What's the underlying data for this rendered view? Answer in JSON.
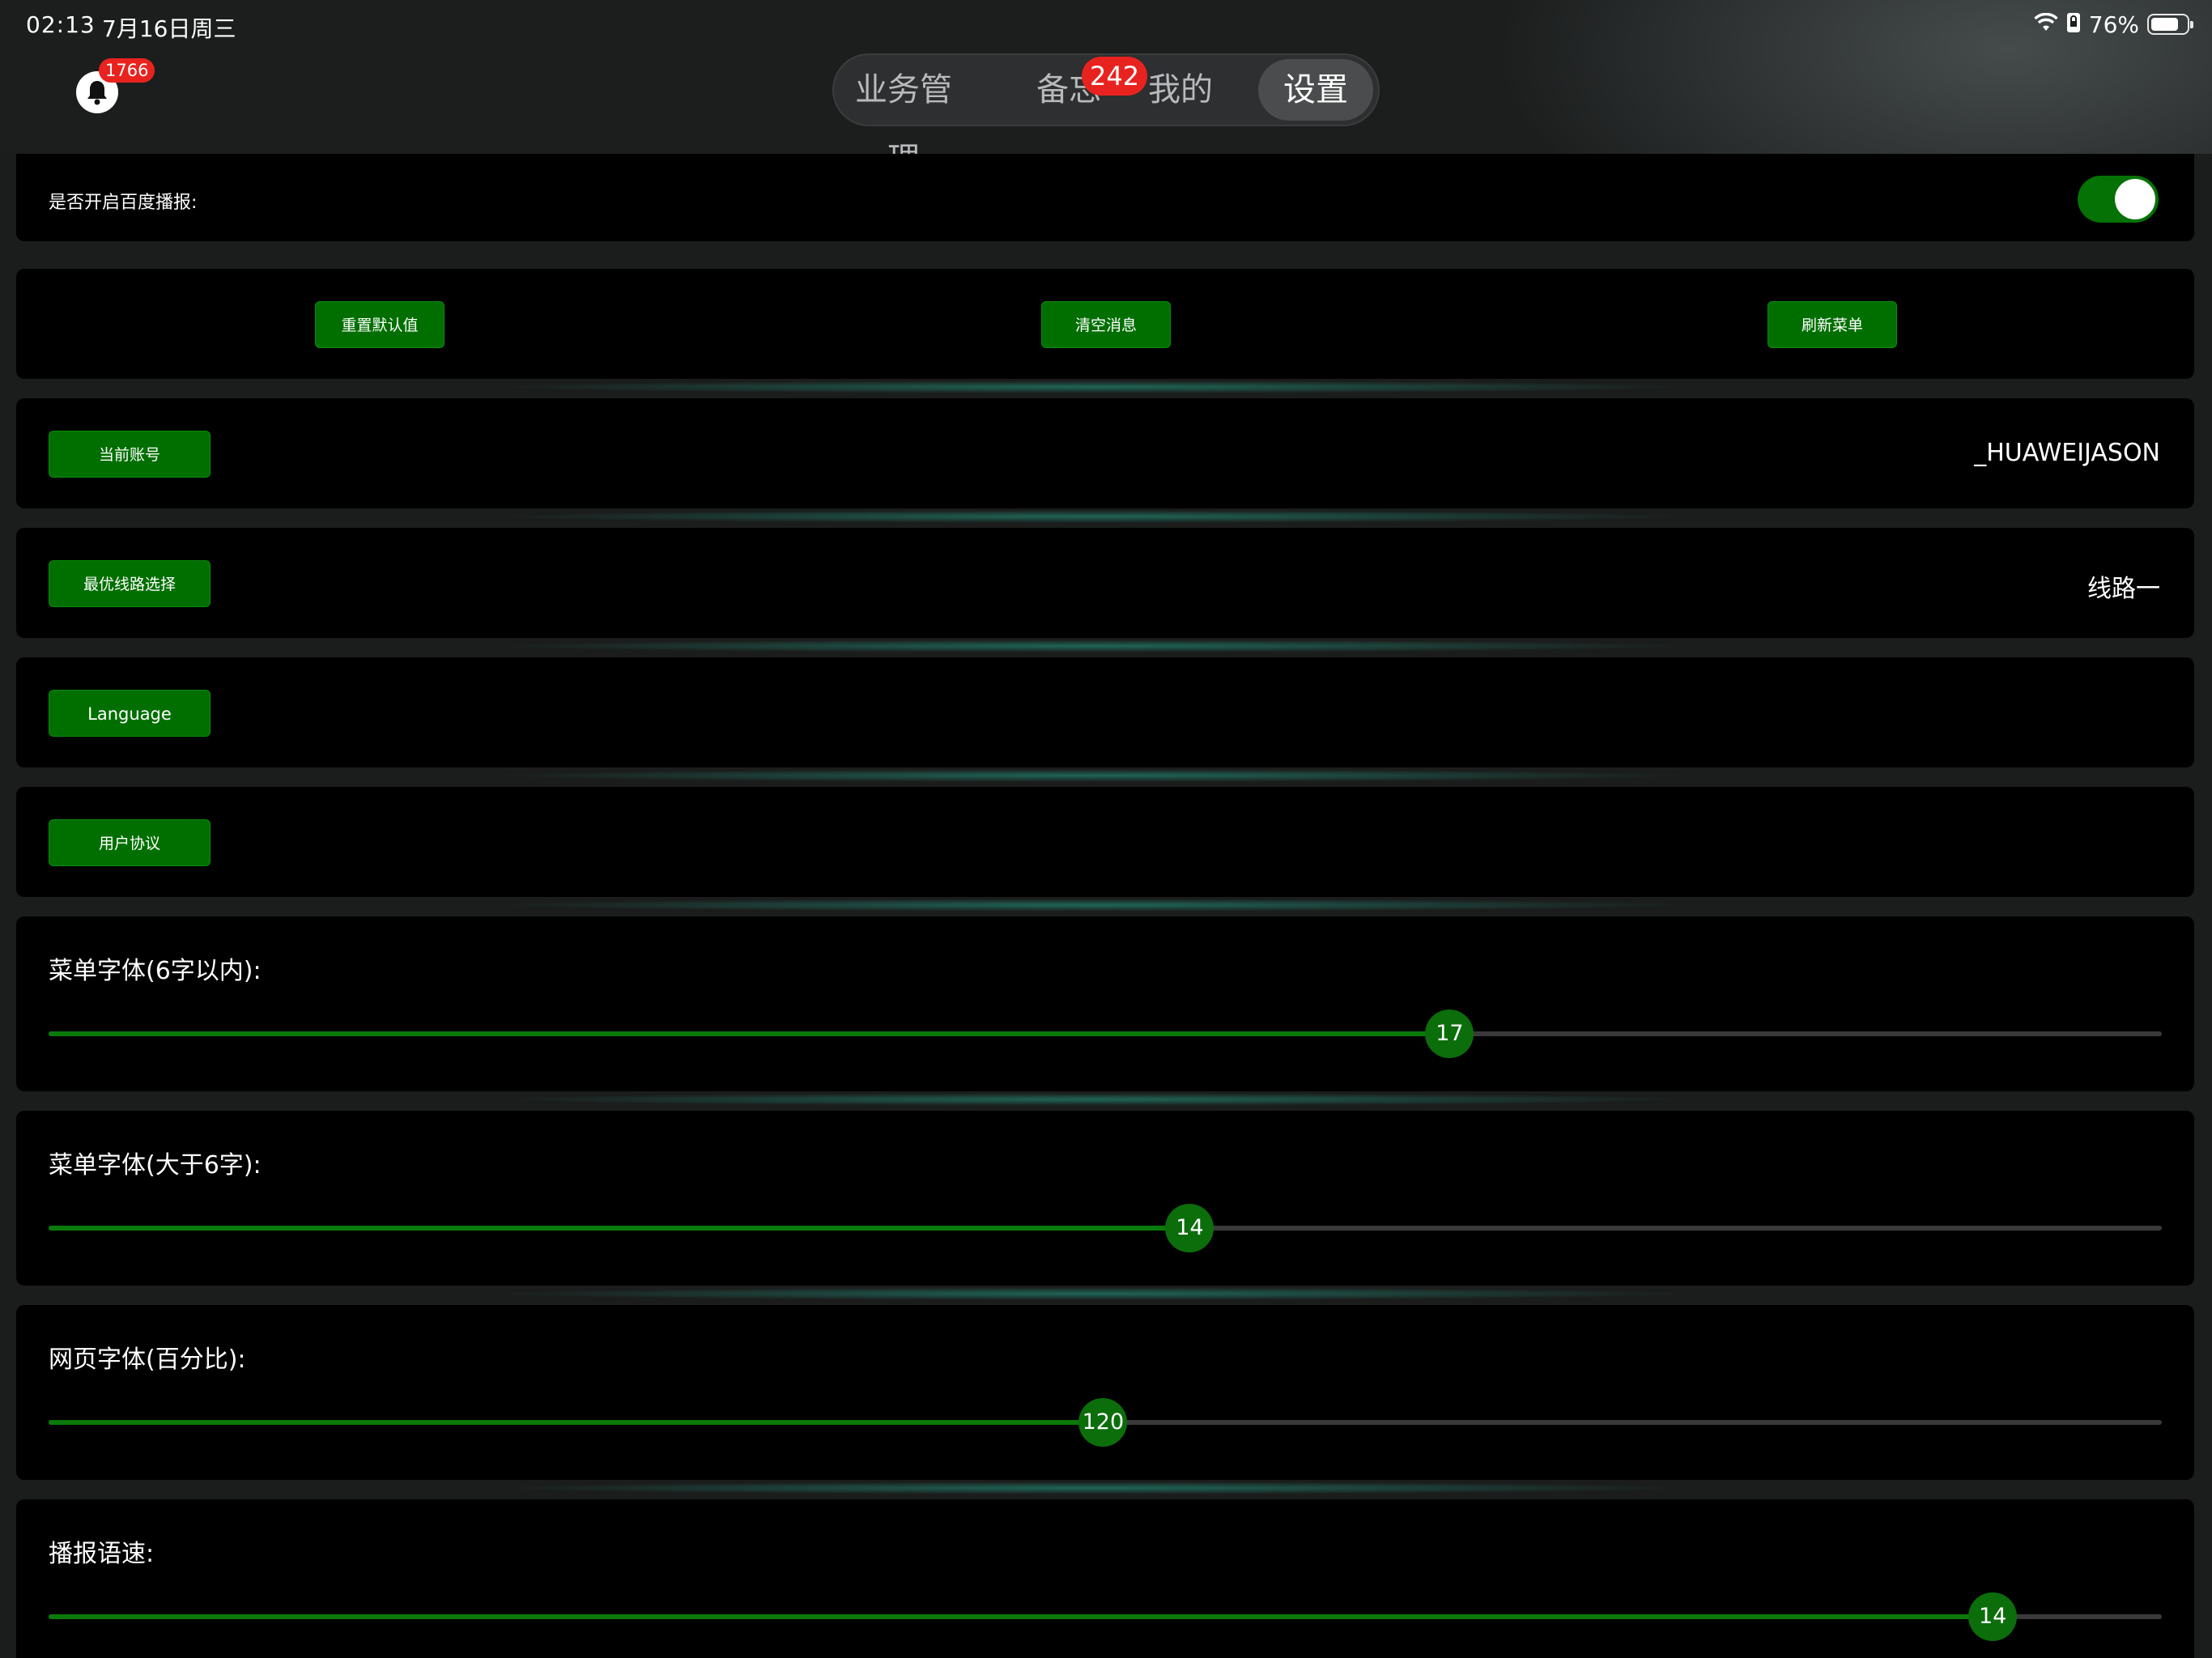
{
  "status_bar": {
    "time": "02:13",
    "date": "7月16日周三",
    "battery_text": "76%",
    "battery_level": 0.76
  },
  "notifications": {
    "icon": "bell-icon",
    "badge": "1766"
  },
  "tabs": [
    {
      "label": "业务管理",
      "active": false
    },
    {
      "label": "备忘",
      "active": false,
      "badge": "242"
    },
    {
      "label": "我的",
      "active": false
    },
    {
      "label": "设置",
      "active": true
    }
  ],
  "settings": {
    "baidu_broadcast": {
      "label": "是否开启百度播报:",
      "enabled": true
    },
    "actions": {
      "reset_label": "重置默认值",
      "clear_label": "清空消息",
      "refresh_label": "刷新菜单"
    },
    "account": {
      "button_label": "当前账号",
      "value": "_HUAWEIJASON"
    },
    "route": {
      "button_label": "最优线路选择",
      "value": "线路一"
    },
    "language": {
      "button_label": "Language"
    },
    "agreement": {
      "button_label": "用户协议"
    },
    "sliders": [
      {
        "title": "菜单字体(6字以内):",
        "value": "17",
        "fraction": 0.663
      },
      {
        "title": "菜单字体(大于6字):",
        "value": "14",
        "fraction": 0.54
      },
      {
        "title": "网页字体(百分比):",
        "value": "120",
        "fraction": 0.499
      },
      {
        "title": "播报语速:",
        "value": "14",
        "fraction": 0.92
      }
    ]
  },
  "colors": {
    "accent_green": "#006f00",
    "badge_red": "#e8231f",
    "card_bg": "#000000"
  }
}
